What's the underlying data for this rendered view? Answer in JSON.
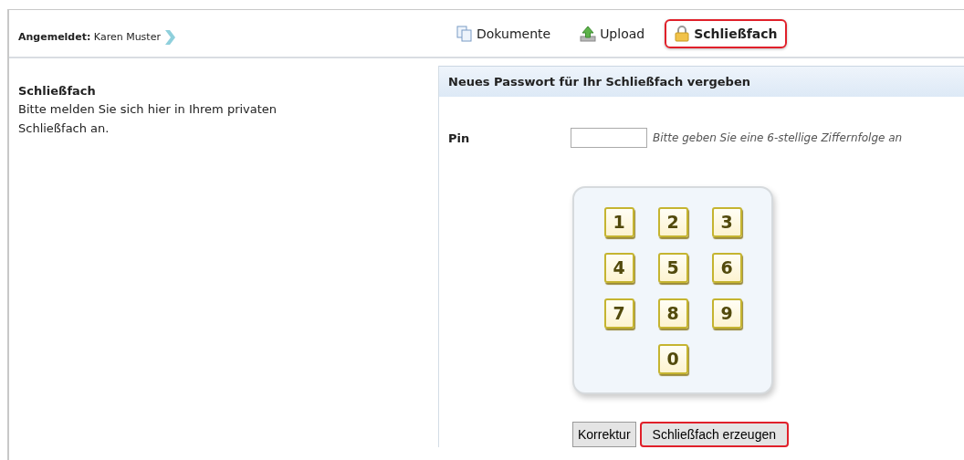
{
  "header": {
    "login_label": "Angemeldet:",
    "user_name": "Karen Muster"
  },
  "tabs": [
    {
      "label": "Dokumente",
      "kind": "documents",
      "selected": false
    },
    {
      "label": "Upload",
      "kind": "upload",
      "selected": false
    },
    {
      "label": "Schließfach",
      "kind": "lock",
      "selected": true
    }
  ],
  "sidebar": {
    "title": "Schließfach",
    "text": "Bitte melden Sie sich hier in Ihrem privaten Schließfach an."
  },
  "panel": {
    "title": "Neues Passwort für Ihr Schließfach vergeben",
    "pin_label": "Pin",
    "pin_hint": "Bitte geben Sie eine 6-stellige Ziffernfolge an",
    "keys": [
      "1",
      "2",
      "3",
      "4",
      "5",
      "6",
      "7",
      "8",
      "9",
      "0"
    ],
    "buttons": [
      {
        "label": "Korrektur",
        "highlighted": false
      },
      {
        "label": "Schließfach erzeugen",
        "highlighted": true
      }
    ]
  }
}
